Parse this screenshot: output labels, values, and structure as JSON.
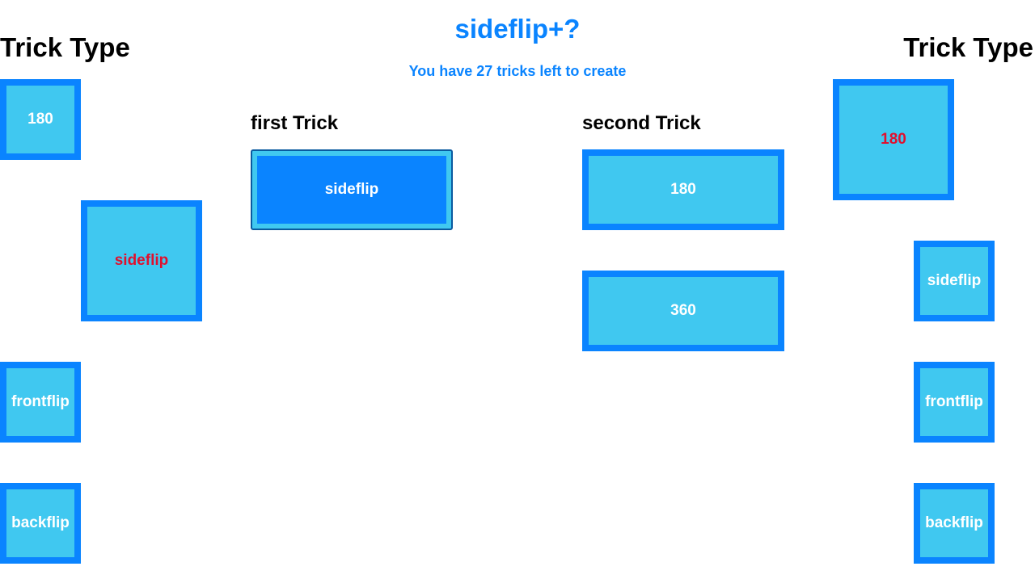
{
  "header": {
    "title": "sideflip+?",
    "subtitle": "You have 27 tricks left to create"
  },
  "left_panel": {
    "heading": "Trick Type",
    "tiles": [
      "180",
      "sideflip",
      "frontflip",
      "backflip"
    ],
    "selected": "sideflip"
  },
  "right_panel": {
    "heading": "Trick Type",
    "tiles": [
      "180",
      "sideflip",
      "frontflip",
      "backflip"
    ],
    "selected": "180"
  },
  "first_trick": {
    "heading": "first Trick",
    "value": "sideflip"
  },
  "second_trick": {
    "heading": "second Trick",
    "options": [
      "180",
      "360"
    ]
  },
  "colors": {
    "accent": "#0a84ff",
    "tile_fill": "#40c8f0",
    "selected_text": "#e0102e"
  }
}
